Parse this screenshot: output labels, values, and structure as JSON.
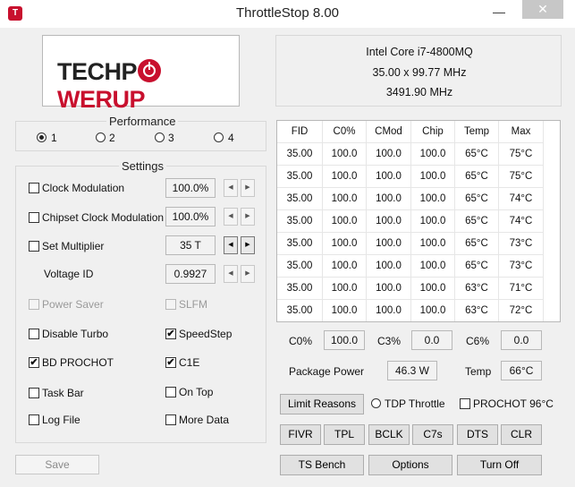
{
  "window": {
    "title": "ThrottleStop 8.00",
    "icon_letter": "T",
    "minimize": "—",
    "close": "✕"
  },
  "logo": {
    "part1": "TECHP",
    "part2": "WERUP"
  },
  "cpu": {
    "name": "Intel Core i7-4800MQ",
    "freq_line": "35.00 x 99.77 MHz",
    "total_freq": "3491.90 MHz"
  },
  "performance": {
    "label": "Performance",
    "options": [
      "1",
      "2",
      "3",
      "4"
    ],
    "selected": 0
  },
  "settings": {
    "label": "Settings",
    "clock_modulation": {
      "label": "Clock Modulation",
      "value": "100.0%",
      "checked": false
    },
    "chipset_clock_modulation": {
      "label": "Chipset Clock Modulation",
      "value": "100.0%",
      "checked": false
    },
    "set_multiplier": {
      "label": "Set Multiplier",
      "value": "35 T",
      "checked": false
    },
    "voltage_id": {
      "label": "Voltage ID",
      "value": "0.9927"
    },
    "power_saver": {
      "label": "Power Saver",
      "checked": false,
      "disabled": true
    },
    "slfm": {
      "label": "SLFM",
      "checked": false,
      "disabled": true
    },
    "disable_turbo": {
      "label": "Disable Turbo",
      "checked": false
    },
    "speedstep": {
      "label": "SpeedStep",
      "checked": true
    },
    "bd_prochot": {
      "label": "BD PROCHOT",
      "checked": true
    },
    "c1e": {
      "label": "C1E",
      "checked": true
    },
    "task_bar": {
      "label": "Task Bar",
      "checked": false
    },
    "on_top": {
      "label": "On Top",
      "checked": false
    },
    "log_file": {
      "label": "Log File",
      "checked": false
    },
    "more_data": {
      "label": "More Data",
      "checked": false
    }
  },
  "arrows": {
    "left": "◀",
    "right": "▶"
  },
  "check_mark": "✔",
  "save_label": "Save",
  "table": {
    "headers": [
      "FID",
      "C0%",
      "CMod",
      "Chip",
      "Temp",
      "Max"
    ],
    "rows": [
      [
        "35.00",
        "100.0",
        "100.0",
        "100.0",
        "65°C",
        "75°C"
      ],
      [
        "35.00",
        "100.0",
        "100.0",
        "100.0",
        "65°C",
        "75°C"
      ],
      [
        "35.00",
        "100.0",
        "100.0",
        "100.0",
        "65°C",
        "74°C"
      ],
      [
        "35.00",
        "100.0",
        "100.0",
        "100.0",
        "65°C",
        "74°C"
      ],
      [
        "35.00",
        "100.0",
        "100.0",
        "100.0",
        "65°C",
        "73°C"
      ],
      [
        "35.00",
        "100.0",
        "100.0",
        "100.0",
        "65°C",
        "73°C"
      ],
      [
        "35.00",
        "100.0",
        "100.0",
        "100.0",
        "63°C",
        "71°C"
      ],
      [
        "35.00",
        "100.0",
        "100.0",
        "100.0",
        "63°C",
        "72°C"
      ]
    ]
  },
  "stats": {
    "c0_label": "C0%",
    "c0_value": "100.0",
    "c3_label": "C3%",
    "c3_value": "0.0",
    "c6_label": "C6%",
    "c6_value": "0.0",
    "package_power_label": "Package Power",
    "package_power_value": "46.3 W",
    "temp_label": "Temp",
    "temp_value": "66°C"
  },
  "limit_reasons_label": "Limit Reasons",
  "tdp_throttle": {
    "label": "TDP Throttle",
    "checked": false
  },
  "prochot96": {
    "label": "PROCHOT 96°C",
    "checked": false
  },
  "buttons_row1": [
    "FIVR",
    "TPL",
    "BCLK",
    "C7s",
    "DTS",
    "CLR"
  ],
  "buttons_row2": [
    "TS Bench",
    "Options",
    "Turn Off"
  ]
}
